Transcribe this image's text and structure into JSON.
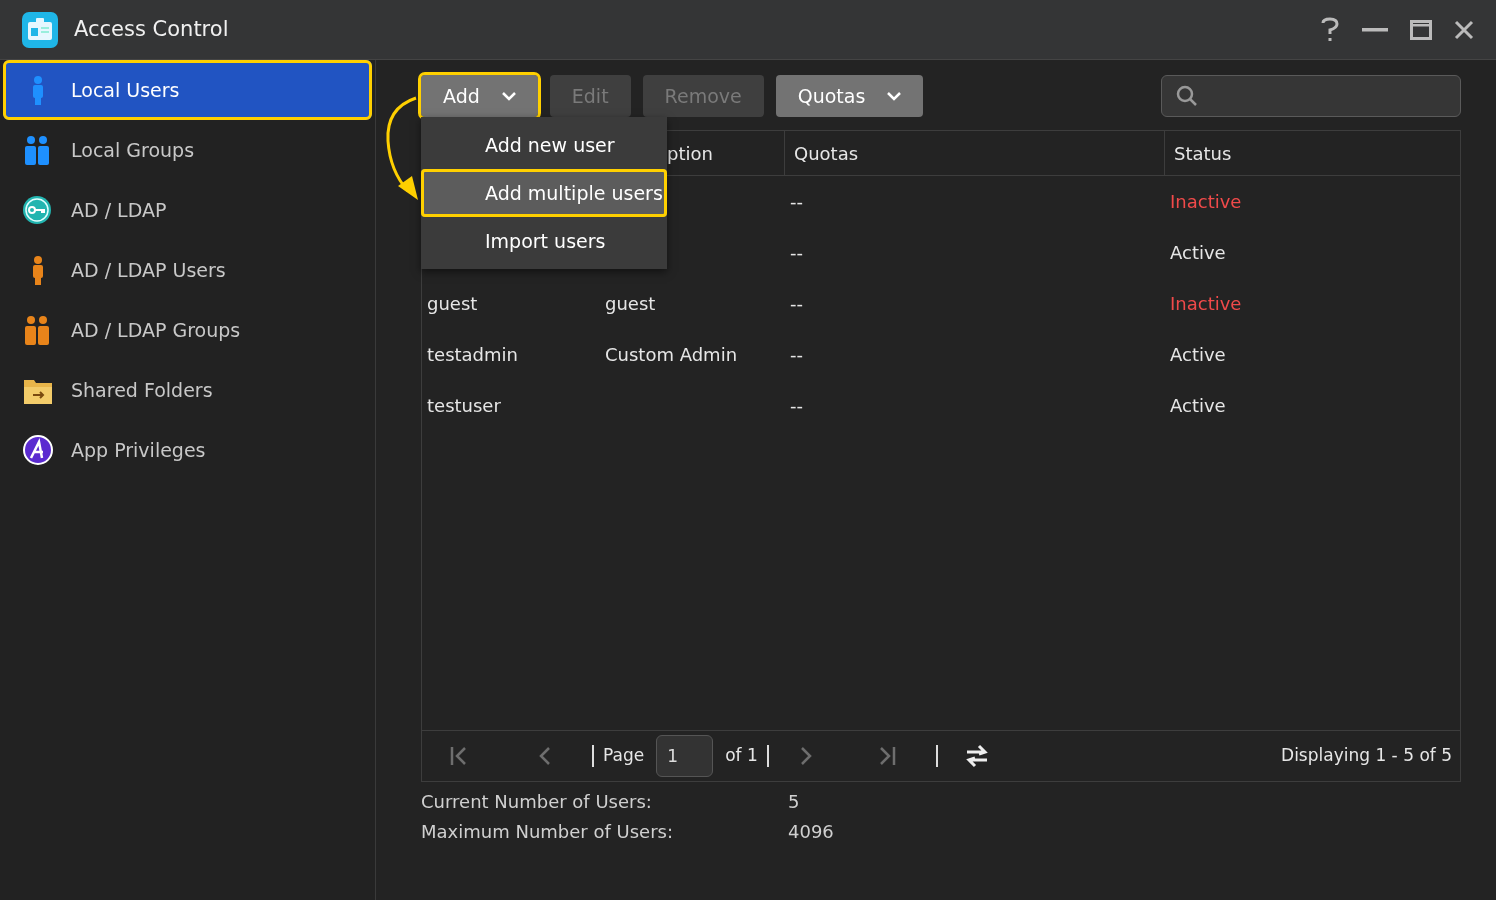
{
  "window": {
    "title": "Access Control"
  },
  "sidebar": {
    "items": [
      {
        "label": "Local Users",
        "kind": "user-blue",
        "selected": true,
        "highlighted": true
      },
      {
        "label": "Local Groups",
        "kind": "group-blue",
        "selected": false,
        "highlighted": false
      },
      {
        "label": "AD / LDAP",
        "kind": "key",
        "selected": false,
        "highlighted": false
      },
      {
        "label": "AD / LDAP Users",
        "kind": "user-orange",
        "selected": false,
        "highlighted": false
      },
      {
        "label": "AD / LDAP Groups",
        "kind": "group-orange",
        "selected": false,
        "highlighted": false
      },
      {
        "label": "Shared Folders",
        "kind": "folder",
        "selected": false,
        "highlighted": false
      },
      {
        "label": "App Privileges",
        "kind": "app",
        "selected": false,
        "highlighted": false
      }
    ]
  },
  "toolbar": {
    "buttons": [
      {
        "label": "Add",
        "disabled": false,
        "caret": true,
        "highlighted": true
      },
      {
        "label": "Edit",
        "disabled": true,
        "caret": false,
        "highlighted": false
      },
      {
        "label": "Remove",
        "disabled": true,
        "caret": false,
        "highlighted": false
      },
      {
        "label": "Quotas",
        "disabled": false,
        "caret": true,
        "highlighted": false
      }
    ]
  },
  "add_menu": {
    "items": [
      {
        "label": "Add new user",
        "selected": false
      },
      {
        "label": "Add multiple users",
        "selected": true
      },
      {
        "label": "Import users",
        "selected": false
      }
    ]
  },
  "table": {
    "columns": [
      {},
      {
        "label": "ption"
      },
      {
        "label": "Quotas"
      },
      {
        "label": "Status"
      }
    ],
    "rows": [
      {
        "quotas": "--",
        "status": "Inactive",
        "active": false
      },
      {
        "quotas": "--",
        "status": "Active",
        "active": true
      },
      {
        "name": "guest",
        "description": "guest",
        "quotas": "--",
        "status": "Inactive",
        "active": false
      },
      {
        "name": "testadmin",
        "description": "Custom Admin",
        "quotas": "--",
        "status": "Active",
        "active": true
      },
      {
        "name": "testuser",
        "quotas": "--",
        "status": "Active",
        "active": true
      }
    ]
  },
  "pager": {
    "page_label": "Page",
    "page": "1",
    "of": "of 1",
    "displaying": "Displaying 1 - 5 of 5"
  },
  "stats": [
    {
      "label": "Current Number of Users:",
      "value": "5"
    },
    {
      "label": "Maximum Number of Users:",
      "value": "4096"
    }
  ]
}
